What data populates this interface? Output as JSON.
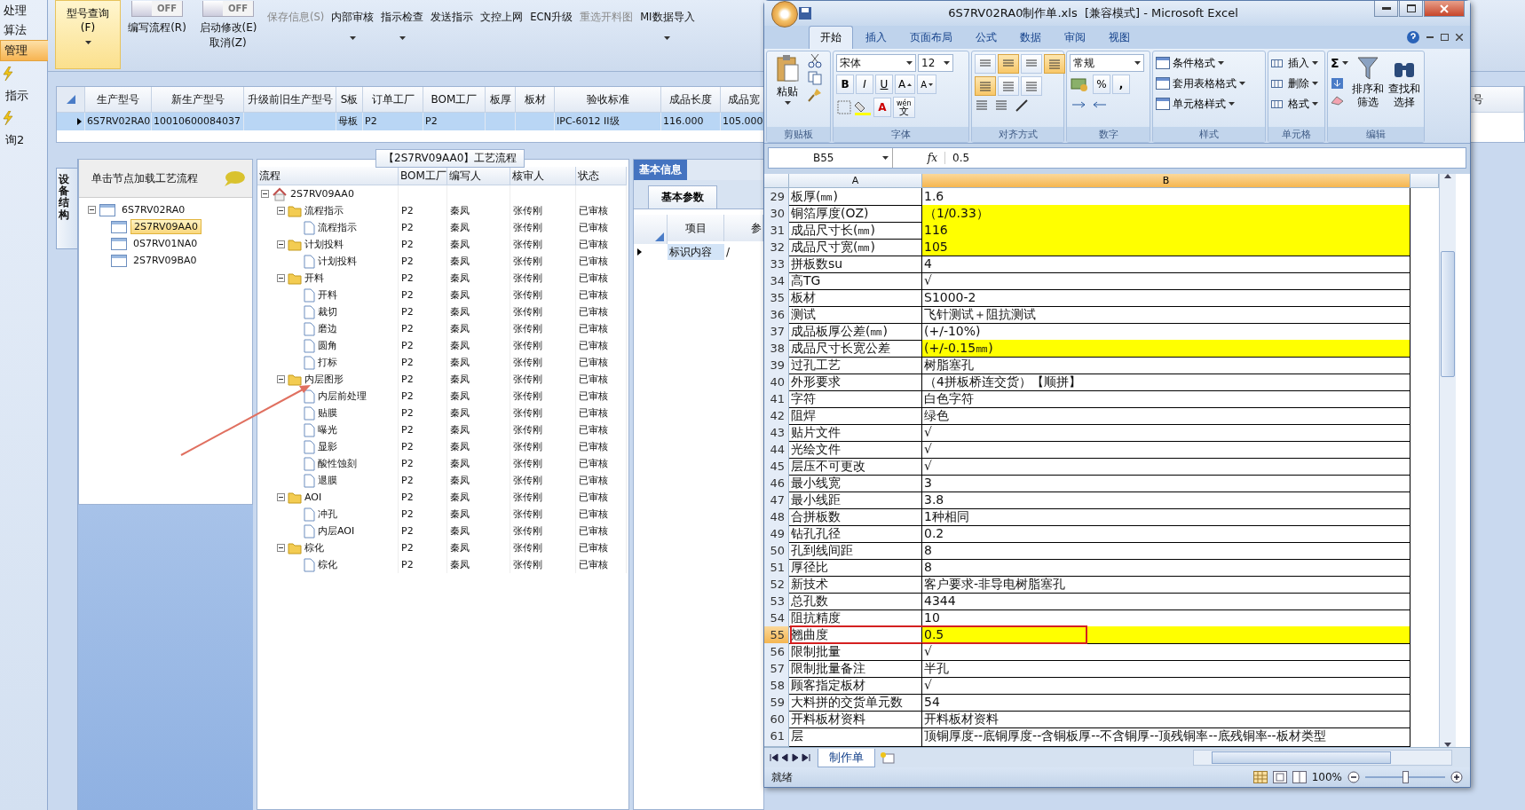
{
  "nav": {
    "items": [
      {
        "label": "处理",
        "selected": false,
        "kind": "text"
      },
      {
        "label": "算法",
        "selected": false,
        "kind": "text"
      },
      {
        "label": "管理",
        "selected": true,
        "kind": "text"
      },
      {
        "label": "指示",
        "selected": false,
        "kind": "icon"
      },
      {
        "label": "询2",
        "selected": false,
        "kind": "icon"
      }
    ]
  },
  "toolbar": {
    "items": [
      {
        "kind": "big-menu",
        "lines": [
          "型号查询(F)"
        ],
        "selected": true,
        "disabled": false
      },
      {
        "kind": "toggle",
        "switch": "OFF",
        "on": false,
        "lines": [
          "编写流程(R)"
        ],
        "selected": false,
        "disabled": false
      },
      {
        "kind": "toggle",
        "switch": "OFF",
        "on": false,
        "lines": [
          "启动修改(E)",
          "取消(Z)"
        ],
        "selected": false,
        "disabled": false
      },
      {
        "kind": "button",
        "lines": [
          "保存信息(S)"
        ],
        "selected": false,
        "disabled": true
      },
      {
        "kind": "menu-button",
        "lines": [
          "内部审核"
        ],
        "selected": false,
        "disabled": false
      },
      {
        "kind": "menu-button",
        "lines": [
          "指示检查"
        ],
        "selected": false,
        "disabled": false
      },
      {
        "kind": "button",
        "lines": [
          "发送指示"
        ],
        "selected": false,
        "disabled": false
      },
      {
        "kind": "button",
        "lines": [
          "文控上网"
        ],
        "selected": false,
        "disabled": false
      },
      {
        "kind": "button",
        "lines": [
          "ECN升级"
        ],
        "selected": false,
        "disabled": false
      },
      {
        "kind": "button",
        "lines": [
          "重选开料图"
        ],
        "selected": false,
        "disabled": true
      },
      {
        "kind": "menu-button",
        "lines": [
          "MI数据导入"
        ],
        "selected": false,
        "disabled": false
      }
    ]
  },
  "grid": {
    "columns": [
      "生产型号",
      "新生产型号",
      "升级前旧生产型号",
      "S板",
      "订单工厂",
      "BOM工厂",
      "板厚",
      "板材",
      "验收标准",
      "成品长度",
      "成品宽",
      "号"
    ],
    "rows": [
      {
        "selected": true,
        "cells": [
          "6S7RV02RA0",
          "10010600084037",
          "",
          "母板",
          "P2",
          "P2",
          "",
          "",
          "IPC-6012 II级",
          "116.000",
          "105.000"
        ]
      }
    ]
  },
  "structure": {
    "tab": "设备结构",
    "header": "单击节点加载工艺流程",
    "tree": {
      "label": "6S7RV02RA0",
      "expanded": true,
      "selected": false,
      "children": [
        {
          "label": "2S7RV09AA0",
          "selected": true
        },
        {
          "label": "0S7RV01NA0",
          "selected": false
        },
        {
          "label": "2S7RV09BA0",
          "selected": false
        }
      ]
    }
  },
  "flow": {
    "title": "【2S7RV09AA0】工艺流程",
    "columns": [
      "流程",
      "BOM工厂",
      "编写人",
      "核审人",
      "状态"
    ],
    "tree": {
      "label": "2S7RV09AA0",
      "kind": "root",
      "expanded": true,
      "children": [
        {
          "label": "流程指示",
          "kind": "folder",
          "expanded": true,
          "bom": "P2",
          "writer": "秦凤",
          "reviewer": "张传刚",
          "status": "已审核",
          "children": [
            {
              "label": "流程指示",
              "kind": "doc",
              "bom": "P2",
              "writer": "秦凤",
              "reviewer": "张传刚",
              "status": "已审核"
            }
          ]
        },
        {
          "label": "计划投料",
          "kind": "folder",
          "expanded": true,
          "bom": "P2",
          "writer": "秦凤",
          "reviewer": "张传刚",
          "status": "已审核",
          "children": [
            {
              "label": "计划投料",
              "kind": "doc",
              "bom": "P2",
              "writer": "秦凤",
              "reviewer": "张传刚",
              "status": "已审核"
            }
          ]
        },
        {
          "label": "开料",
          "kind": "folder",
          "expanded": true,
          "bom": "P2",
          "writer": "秦凤",
          "reviewer": "张传刚",
          "status": "已审核",
          "children": [
            {
              "label": "开料",
              "kind": "doc",
              "bom": "P2",
              "writer": "秦凤",
              "reviewer": "张传刚",
              "status": "已审核"
            },
            {
              "label": "裁切",
              "kind": "doc",
              "bom": "P2",
              "writer": "秦凤",
              "reviewer": "张传刚",
              "status": "已审核"
            },
            {
              "label": "磨边",
              "kind": "doc",
              "bom": "P2",
              "writer": "秦凤",
              "reviewer": "张传刚",
              "status": "已审核"
            },
            {
              "label": "圆角",
              "kind": "doc",
              "bom": "P2",
              "writer": "秦凤",
              "reviewer": "张传刚",
              "status": "已审核"
            },
            {
              "label": "打标",
              "kind": "doc",
              "bom": "P2",
              "writer": "秦凤",
              "reviewer": "张传刚",
              "status": "已审核"
            }
          ]
        },
        {
          "label": "内层图形",
          "kind": "folder",
          "expanded": true,
          "bom": "P2",
          "writer": "秦凤",
          "reviewer": "张传刚",
          "status": "已审核",
          "children": [
            {
              "label": "内层前处理",
              "kind": "doc",
              "bom": "P2",
              "writer": "秦凤",
              "reviewer": "张传刚",
              "status": "已审核"
            },
            {
              "label": "贴膜",
              "kind": "doc",
              "bom": "P2",
              "writer": "秦凤",
              "reviewer": "张传刚",
              "status": "已审核"
            },
            {
              "label": "曝光",
              "kind": "doc",
              "bom": "P2",
              "writer": "秦凤",
              "reviewer": "张传刚",
              "status": "已审核"
            },
            {
              "label": "显影",
              "kind": "doc",
              "bom": "P2",
              "writer": "秦凤",
              "reviewer": "张传刚",
              "status": "已审核"
            },
            {
              "label": "酸性蚀刻",
              "kind": "doc",
              "bom": "P2",
              "writer": "秦凤",
              "reviewer": "张传刚",
              "status": "已审核"
            },
            {
              "label": "退膜",
              "kind": "doc",
              "bom": "P2",
              "writer": "秦凤",
              "reviewer": "张传刚",
              "status": "已审核"
            }
          ]
        },
        {
          "label": "AOI",
          "kind": "folder",
          "expanded": true,
          "bom": "P2",
          "writer": "秦凤",
          "reviewer": "张传刚",
          "status": "已审核",
          "children": [
            {
              "label": "冲孔",
              "kind": "doc",
              "bom": "P2",
              "writer": "秦凤",
              "reviewer": "张传刚",
              "status": "已审核"
            },
            {
              "label": "内层AOI",
              "kind": "doc",
              "bom": "P2",
              "writer": "秦凤",
              "reviewer": "张传刚",
              "status": "已审核"
            }
          ]
        },
        {
          "label": "棕化",
          "kind": "folder",
          "expanded": true,
          "bom": "P2",
          "writer": "秦凤",
          "reviewer": "张传刚",
          "status": "已审核",
          "children": [
            {
              "label": "棕化",
              "kind": "doc",
              "bom": "P2",
              "writer": "秦凤",
              "reviewer": "张传刚",
              "status": "已审核"
            }
          ]
        }
      ]
    }
  },
  "info": {
    "tabs": [
      {
        "label": "基本信息",
        "selected": true
      }
    ],
    "subtabs": [
      {
        "label": "基本参数",
        "selected": true
      }
    ],
    "columns": [
      "项目",
      "参"
    ],
    "rows": [
      {
        "selected": true,
        "cells": [
          "标识内容",
          "/"
        ]
      }
    ]
  },
  "excel": {
    "title": "6S7RV02RA0制作单.xls  [兼容模式] - Microsoft Excel",
    "tabs": [
      {
        "label": "开始",
        "selected": true
      },
      {
        "label": "插入",
        "selected": false
      },
      {
        "label": "页面布局",
        "selected": false
      },
      {
        "label": "公式",
        "selected": false
      },
      {
        "label": "数据",
        "selected": false
      },
      {
        "label": "审阅",
        "selected": false
      },
      {
        "label": "视图",
        "selected": false
      }
    ],
    "clipboard": {
      "paste": "粘贴",
      "group": "剪贴板"
    },
    "font": {
      "name": "宋体",
      "size": "12",
      "styles": [
        "B",
        "I",
        "U"
      ],
      "grow": "A",
      "shrink": "A",
      "color_button": "A",
      "phonetic_top": "wén",
      "phonetic": "文",
      "group": "字体"
    },
    "alignment": {
      "group": "对齐方式",
      "vertical": [
        {
          "selected": false
        },
        {
          "selected": true
        },
        {
          "selected": false
        }
      ],
      "horizontal": [
        {
          "selected": true
        },
        {
          "selected": false
        },
        {
          "selected": false
        }
      ],
      "wrap": {
        "selected": true
      }
    },
    "number": {
      "format": "常规",
      "percent": "%",
      "comma": ",",
      "group": "数字"
    },
    "styles": {
      "items": [
        "条件格式",
        "套用表格格式",
        "单元格样式"
      ],
      "group": "样式"
    },
    "cells": {
      "items": [
        "插入",
        "删除",
        "格式"
      ],
      "group": "单元格"
    },
    "editing": {
      "sum": "Σ",
      "sort": [
        "排序和",
        "筛选"
      ],
      "find": [
        "查找和",
        "选择"
      ],
      "group": "编辑"
    },
    "formula_bar": {
      "cell": "B55",
      "fx": "fx",
      "value": "0.5"
    },
    "columns": [
      {
        "label": "A",
        "selected": false
      },
      {
        "label": "B",
        "selected": true
      }
    ],
    "rows": [
      {
        "n": "29",
        "a": "板厚(㎜)",
        "b": "1.6",
        "highlighted": false,
        "selected": false,
        "boxed": false
      },
      {
        "n": "30",
        "a": "铜箔厚度(OZ)",
        "b": "（1/0.33）",
        "highlighted": true,
        "selected": false,
        "boxed": false
      },
      {
        "n": "31",
        "a": "成品尺寸长(㎜)",
        "b": "116",
        "highlighted": true,
        "selected": false,
        "boxed": false
      },
      {
        "n": "32",
        "a": "成品尺寸宽(㎜)",
        "b": "105",
        "highlighted": true,
        "selected": false,
        "boxed": false
      },
      {
        "n": "33",
        "a": "拼板数su",
        "b": "4",
        "highlighted": false,
        "selected": false,
        "boxed": false
      },
      {
        "n": "34",
        "a": "高TG",
        "b": "√",
        "highlighted": false,
        "selected": false,
        "boxed": false
      },
      {
        "n": "35",
        "a": "板材",
        "b": "S1000-2",
        "highlighted": false,
        "selected": false,
        "boxed": false
      },
      {
        "n": "36",
        "a": "测试",
        "b": "飞针测试＋阻抗测试",
        "highlighted": false,
        "selected": false,
        "boxed": false
      },
      {
        "n": "37",
        "a": "成品板厚公差(㎜)",
        "b": "(+/-10%)",
        "highlighted": false,
        "selected": false,
        "boxed": false
      },
      {
        "n": "38",
        "a": "成品尺寸长宽公差",
        "b": "(+/-0.15㎜)",
        "highlighted": true,
        "selected": false,
        "boxed": false
      },
      {
        "n": "39",
        "a": "过孔工艺",
        "b": "树脂塞孔",
        "highlighted": false,
        "selected": false,
        "boxed": false
      },
      {
        "n": "40",
        "a": "外形要求",
        "b": "（4拼板桥连交货）【顺拼】",
        "highlighted": false,
        "selected": false,
        "boxed": false
      },
      {
        "n": "41",
        "a": "字符",
        "b": "白色字符",
        "highlighted": false,
        "selected": false,
        "boxed": false
      },
      {
        "n": "42",
        "a": "阻焊",
        "b": "绿色",
        "highlighted": false,
        "selected": false,
        "boxed": false
      },
      {
        "n": "43",
        "a": "贴片文件",
        "b": "√",
        "highlighted": false,
        "selected": false,
        "boxed": false
      },
      {
        "n": "44",
        "a": "光绘文件",
        "b": "√",
        "highlighted": false,
        "selected": false,
        "boxed": false
      },
      {
        "n": "45",
        "a": "层压不可更改",
        "b": "√",
        "highlighted": false,
        "selected": false,
        "boxed": false
      },
      {
        "n": "46",
        "a": "最小线宽",
        "b": "3",
        "highlighted": false,
        "selected": false,
        "boxed": false
      },
      {
        "n": "47",
        "a": "最小线距",
        "b": "3.8",
        "highlighted": false,
        "selected": false,
        "boxed": false
      },
      {
        "n": "48",
        "a": "合拼板数",
        "b": "1种相同",
        "highlighted": false,
        "selected": false,
        "boxed": false
      },
      {
        "n": "49",
        "a": "钻孔孔径",
        "b": "0.2",
        "highlighted": false,
        "selected": false,
        "boxed": false
      },
      {
        "n": "50",
        "a": "孔到线间距",
        "b": "8",
        "highlighted": false,
        "selected": false,
        "boxed": false
      },
      {
        "n": "51",
        "a": "厚径比",
        "b": "8",
        "highlighted": false,
        "selected": false,
        "boxed": false
      },
      {
        "n": "52",
        "a": "新技术",
        "b": "客户要求-非导电树脂塞孔",
        "highlighted": false,
        "selected": false,
        "boxed": false
      },
      {
        "n": "53",
        "a": "总孔数",
        "b": "4344",
        "highlighted": false,
        "selected": false,
        "boxed": false
      },
      {
        "n": "54",
        "a": "阻抗精度",
        "b": "10",
        "highlighted": false,
        "selected": false,
        "boxed": false
      },
      {
        "n": "55",
        "a": "翘曲度",
        "b": "0.5",
        "highlighted": true,
        "selected": true,
        "boxed": true
      },
      {
        "n": "56",
        "a": "限制批量",
        "b": "√",
        "highlighted": false,
        "selected": false,
        "boxed": false
      },
      {
        "n": "57",
        "a": "限制批量备注",
        "b": "半孔",
        "highlighted": false,
        "selected": false,
        "boxed": false
      },
      {
        "n": "58",
        "a": "顾客指定板材",
        "b": "√",
        "highlighted": false,
        "selected": false,
        "boxed": false
      },
      {
        "n": "59",
        "a": "大料拼的交货单元数",
        "b": "54",
        "highlighted": false,
        "selected": false,
        "boxed": false
      },
      {
        "n": "60",
        "a": "开料板材资料",
        "b": "开料板材资料",
        "highlighted": false,
        "selected": false,
        "boxed": false
      },
      {
        "n": "61",
        "a": "层",
        "b": "顶铜厚度--底铜厚度--含铜板厚--不含铜厚--顶残铜率--底残铜率--板材类型",
        "highlighted": false,
        "selected": false,
        "boxed": false
      }
    ],
    "sheet_tabs": [
      {
        "label": "制作单",
        "selected": true
      }
    ],
    "status": "就绪",
    "zoom": {
      "label": "100%",
      "level": 0.5
    }
  }
}
